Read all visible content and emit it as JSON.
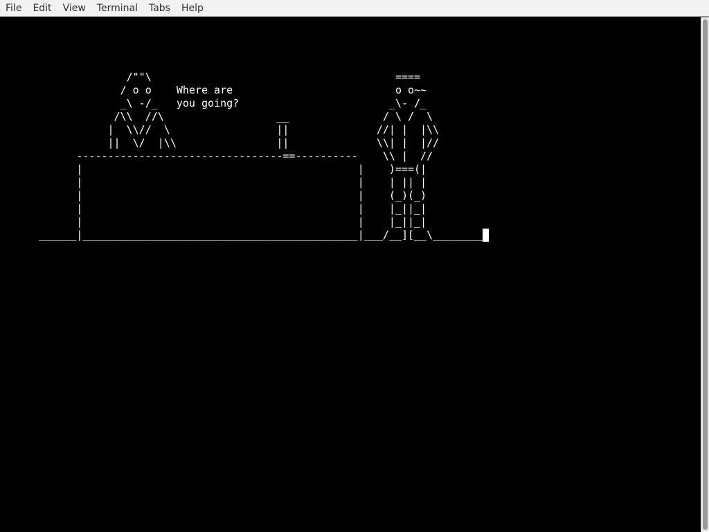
{
  "menubar": {
    "items": [
      "File",
      "Edit",
      "View",
      "Terminal",
      "Tabs",
      "Help"
    ]
  },
  "terminal": {
    "lines": [
      "",
      "",
      "",
      "",
      "                    /\"\"\\                                       ====",
      "                   / o o    Where are                          o o~~",
      "                   _\\ -/_   you going?                        _\\- /_",
      "                  /\\\\  //\\                  __               / \\ /  \\",
      "                 |  \\\\//  \\                 ||              //| |  |\\\\",
      "                 ||  \\/  |\\\\                ||              \\\\| |  |//",
      "            ---------------------------------==----------    \\\\ |  //",
      "            |                                            |    )===(|",
      "            |                                            |    | || |",
      "            |                                            |    (_)(_)",
      "            |                                            |    |_||_|",
      "            |                                            |    |_||_|",
      "      ______|____________________________________________|___/__][__\\________"
    ],
    "cursor_line": 16
  },
  "colors": {
    "terminal_background": "#000000",
    "terminal_foreground": "#ffffff",
    "menubar_background": "#f2f2f2",
    "scrollbar_thumb": "#9b9b9b"
  }
}
